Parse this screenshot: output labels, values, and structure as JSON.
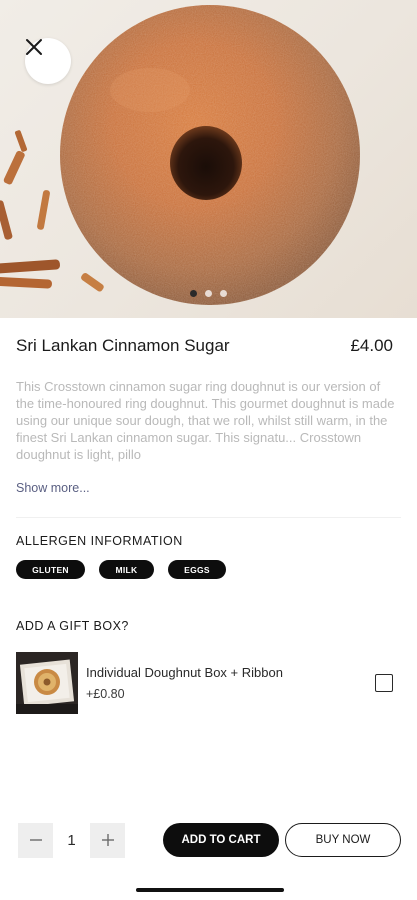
{
  "product": {
    "title": "Sri Lankan Cinnamon Sugar",
    "price": "£4.00",
    "description": "This Crosstown cinnamon sugar ring doughnut is our version of the time-honoured ring doughnut. This gourmet doughnut is made using our unique sour dough, that we roll, whilst still warm, in the finest Sri Lankan cinnamon sugar. This signatu... Crosstown doughnut is light, pillo",
    "show_more": "Show more..."
  },
  "gallery": {
    "image_count": 3,
    "active_index": 0
  },
  "icons": {
    "close": "close-icon",
    "minus": "minus-icon",
    "plus": "plus-icon",
    "checkbox": "checkbox-icon"
  },
  "allergens": {
    "heading": "ALLERGEN INFORMATION",
    "items": [
      "GLUTEN",
      "MILK",
      "EGGS"
    ]
  },
  "gift_box": {
    "heading": "ADD A GIFT BOX?",
    "option_name": "Individual Doughnut Box + Ribbon",
    "option_price": "+£0.80",
    "checked": false
  },
  "cart": {
    "quantity": "1",
    "add_to_cart_label": "ADD TO CART",
    "buy_now_label": "BUY NOW"
  },
  "colors": {
    "primary": "#0d0d0d",
    "chip_bg": "#0d0d0d",
    "muted_text": "#b9b9b9",
    "link": "#5a5f82"
  }
}
